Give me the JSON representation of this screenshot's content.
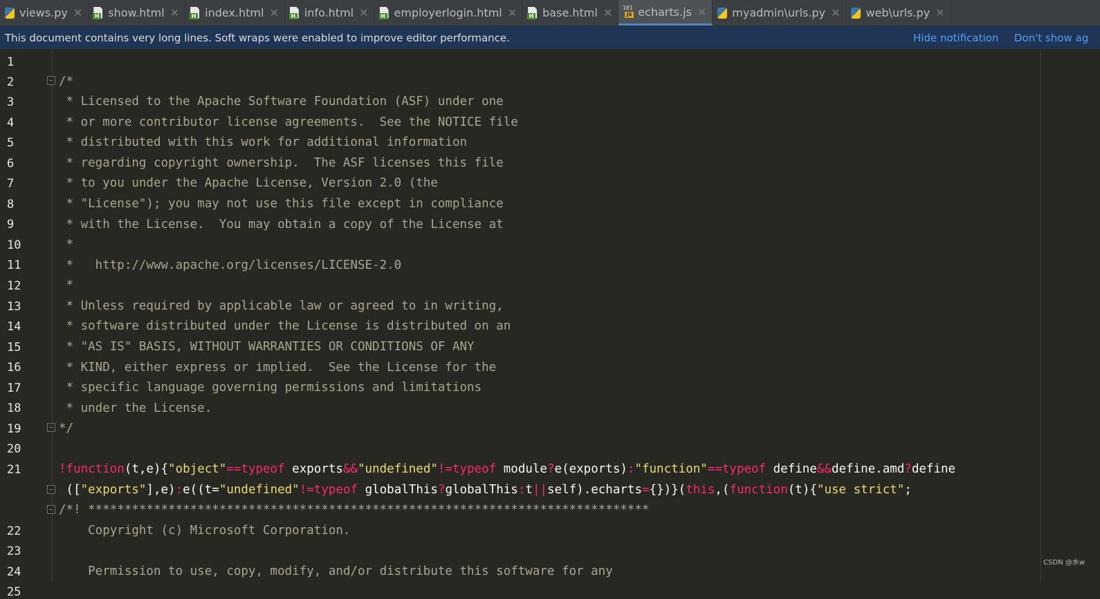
{
  "tabs": [
    {
      "label": "views.py",
      "icon": "python-file-icon",
      "type": "py",
      "active": false
    },
    {
      "label": "show.html",
      "icon": "html-file-icon",
      "type": "html",
      "active": false
    },
    {
      "label": "index.html",
      "icon": "html-file-icon",
      "type": "html",
      "active": false
    },
    {
      "label": "info.html",
      "icon": "html-file-icon",
      "type": "html",
      "active": false
    },
    {
      "label": "employerlogin.html",
      "icon": "html-file-icon",
      "type": "html",
      "active": false
    },
    {
      "label": "base.html",
      "icon": "html-file-icon",
      "type": "html",
      "active": false
    },
    {
      "label": "echarts.js",
      "icon": "js-file-icon",
      "type": "js",
      "active": true
    },
    {
      "label": "myadmin\\urls.py",
      "icon": "python-file-icon",
      "type": "py",
      "active": false
    },
    {
      "label": "web\\urls.py",
      "icon": "python-file-icon",
      "type": "py",
      "active": false
    }
  ],
  "tab_close_glyph": "✕",
  "notification": {
    "message": "This document contains very long lines. Soft wraps were enabled to improve editor performance.",
    "hide_label": "Hide notification",
    "dont_show_label": "Don't show ag"
  },
  "line_numbers": [
    "1",
    "2",
    "3",
    "4",
    "5",
    "6",
    "7",
    "8",
    "9",
    "10",
    "11",
    "12",
    "13",
    "14",
    "15",
    "16",
    "17",
    "18",
    "19",
    "20",
    "21",
    "22",
    "23",
    "24",
    "25"
  ],
  "code": {
    "l2": "/*",
    "l3": " * Licensed to the Apache Software Foundation (ASF) under one",
    "l4": " * or more contributor license agreements.  See the NOTICE file",
    "l5": " * distributed with this work for additional information",
    "l6": " * regarding copyright ownership.  The ASF licenses this file",
    "l7": " * to you under the Apache License, Version 2.0 (the",
    "l8": " * \"License\"); you may not use this file except in compliance",
    "l9": " * with the License.  You may obtain a copy of the License at",
    "l10": " *",
    "l11": " *   http://www.apache.org/licenses/LICENSE-2.0",
    "l12": " *",
    "l13": " * Unless required by applicable law or agreed to in writing,",
    "l14": " * software distributed under the License is distributed on an",
    "l15": " * \"AS IS\" BASIS, WITHOUT WARRANTIES OR CONDITIONS OF ANY",
    "l16": " * KIND, either express or implied.  See the License for the",
    "l17": " * specific language governing permissions and limitations",
    "l18": " * under the License.",
    "l19": "*/",
    "l21a": {
      "p1": "!function",
      "p2": "(t,e){",
      "p3": "\"object\"",
      "p4": "==typeof",
      "p5": " exports",
      "p6": "&&",
      "p7": "\"undefined\"",
      "p8": "!=typeof",
      "p9": " module",
      "p10": "?",
      "p11": "e(exports)",
      "p12": ":",
      "p13": "\"function\"",
      "p14": "==typeof",
      "p15": " define",
      "p16": "&&",
      "p17": "define.amd",
      "p18": "?",
      "p19": "define"
    },
    "l21b": {
      "p1": " ([",
      "p2": "\"exports\"",
      "p3": "],e)",
      "p4": ":",
      "p5": "e((t=",
      "p6": "\"undefined\"",
      "p7": "!=typeof",
      "p8": " globalThis",
      "p9": "?",
      "p10": "globalThis",
      "p11": ":",
      "p12": "t",
      "p13": "||",
      "p14": "self).echarts",
      "p15": "=",
      "p16": "{})}(",
      "p17": "this",
      "p18": ",(",
      "p19": "function",
      "p20": "(t){",
      "p21": "\"use strict\"",
      "p22": ";"
    },
    "l22": "/*! *****************************************************************************",
    "l23": "    Copyright (c) Microsoft Corporation.",
    "l25": "    Permission to use, copy, modify, and/or distribute this software for any"
  },
  "watermark": "CSDN @水w"
}
